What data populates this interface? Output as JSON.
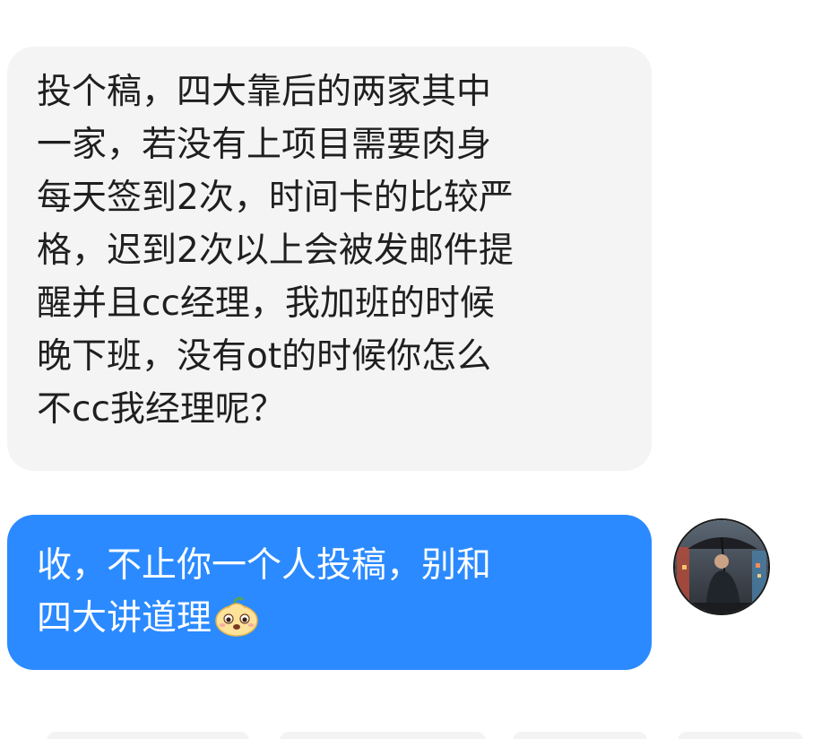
{
  "conversation": {
    "incoming": {
      "lines": [
        "投个稿，四大靠后的两家其中",
        "一家，若没有上项目需要肉身",
        "每天签到2次，时间卡的比较严",
        "格，迟到2次以上会被发邮件提",
        "醒并且cc经理，我加班的时候",
        "晚下班，没有ot的时候你怎么",
        "不cc我经理呢？"
      ]
    },
    "outgoing": {
      "lines": [
        "收，不止你一个人投稿，别和",
        "四大讲道理"
      ],
      "emoji": "bun-face-emoji-icon"
    },
    "avatar": {
      "icon": "person-with-umbrella-avatar"
    }
  },
  "colors": {
    "incoming_bubble": "#f4f4f5",
    "outgoing_bubble": "#2b8aff",
    "incoming_text": "#1f1f1f",
    "outgoing_text": "#ffffff"
  }
}
